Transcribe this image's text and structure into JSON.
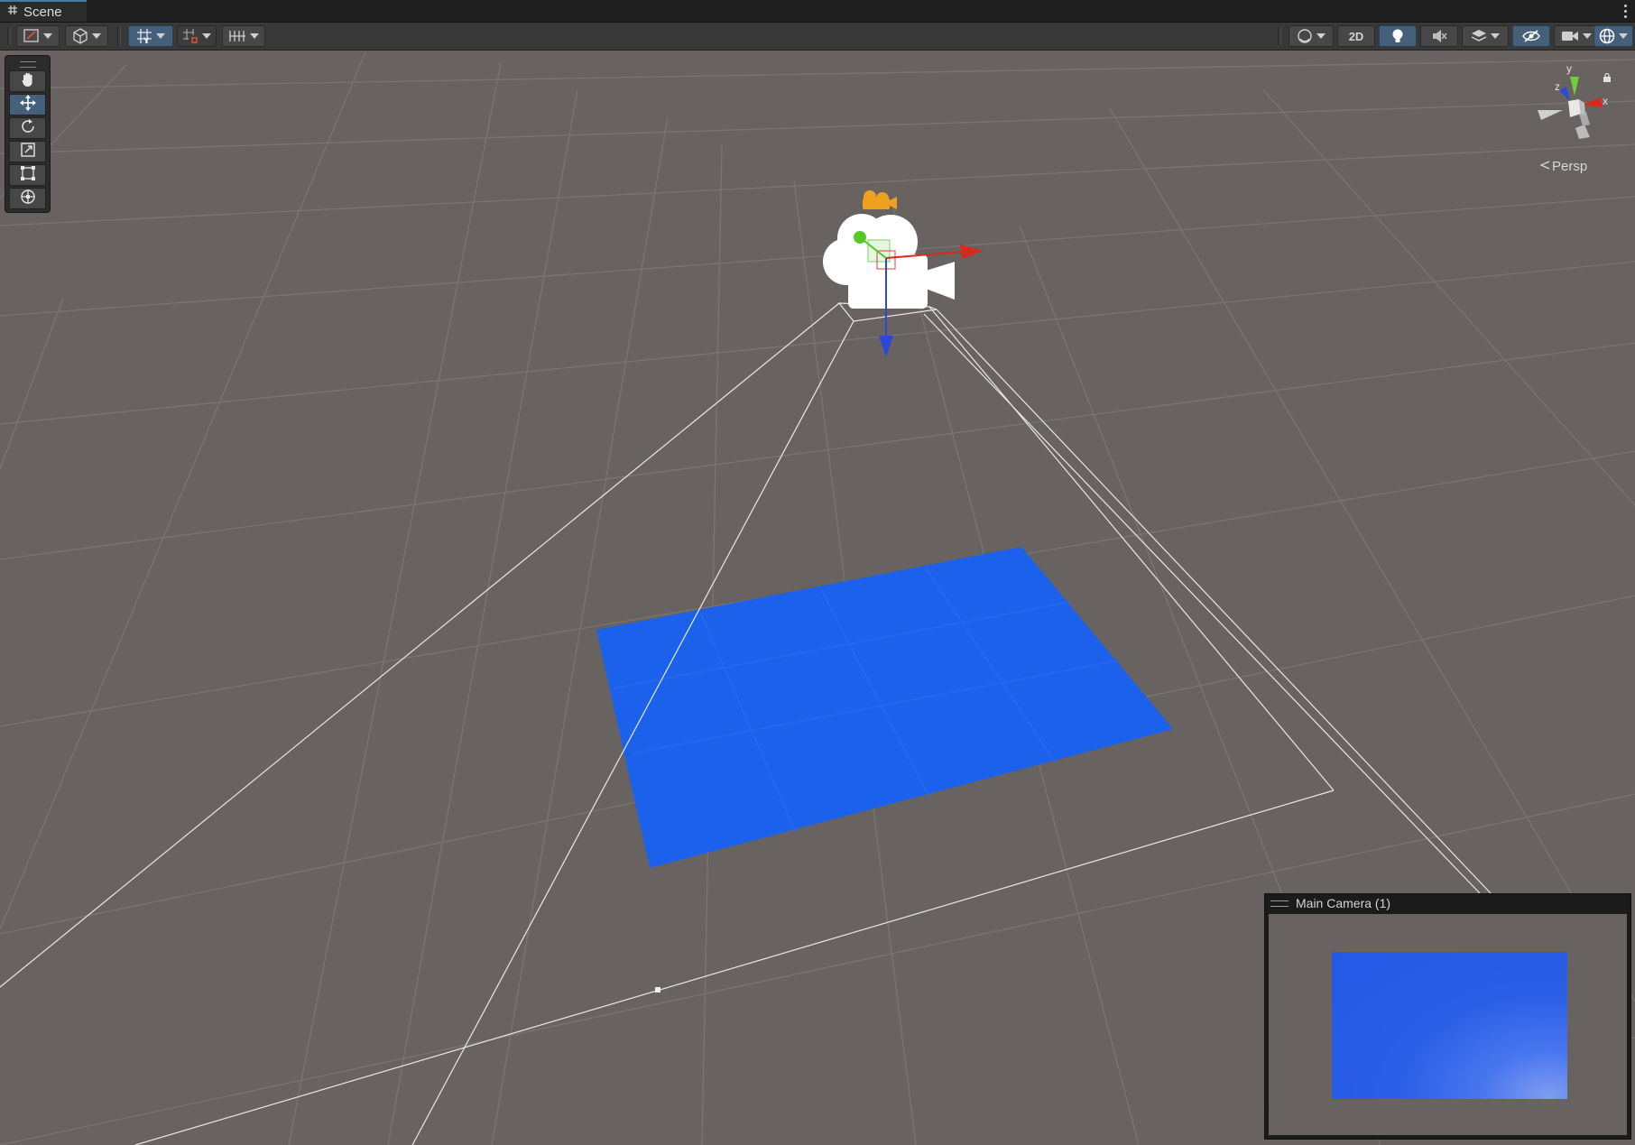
{
  "tab": {
    "title": "Scene",
    "icon": "grid-icon",
    "menu": "kebab-menu-icon"
  },
  "toolbar": {
    "left": [
      {
        "name": "draw-mode-button",
        "icon": "shaded-draw-icon",
        "dropdown": true
      },
      {
        "name": "render-mode-button",
        "icon": "cube-icon",
        "dropdown": true
      },
      {
        "name": "grid-toggle-button",
        "icon": "grid-y-icon",
        "dropdown": true,
        "active": true
      },
      {
        "name": "snap-button",
        "icon": "snap-grid-icon",
        "dropdown": true
      },
      {
        "name": "increment-snap-button",
        "icon": "increment-snap-icon",
        "dropdown": true
      }
    ],
    "right": [
      {
        "name": "shading-button",
        "icon": "sphere-icon",
        "dropdown": true
      },
      {
        "name": "two-d-button",
        "label": "2D"
      },
      {
        "name": "lighting-button",
        "icon": "lightbulb-icon",
        "active": true
      },
      {
        "name": "audio-button",
        "icon": "audio-mute-icon"
      },
      {
        "name": "effects-button",
        "icon": "layers-icon",
        "dropdown": true
      },
      {
        "name": "visibility-button",
        "icon": "eye-hidden-icon",
        "active": true
      },
      {
        "name": "camera-button",
        "icon": "camera-icon",
        "dropdown": true
      },
      {
        "name": "gizmos-button",
        "icon": "gizmo-globe-icon",
        "dropdown": true,
        "active": true
      }
    ],
    "two_d_label": "2D"
  },
  "tools": [
    {
      "name": "hand-tool",
      "icon": "hand-icon",
      "active": false
    },
    {
      "name": "move-tool",
      "icon": "move-arrows-icon",
      "active": true
    },
    {
      "name": "rotate-tool",
      "icon": "rotate-icon",
      "active": false
    },
    {
      "name": "scale-tool",
      "icon": "scale-icon",
      "active": false
    },
    {
      "name": "rect-tool",
      "icon": "rect-transform-icon",
      "active": false
    },
    {
      "name": "transform-tool",
      "icon": "transform-icon",
      "active": false
    }
  ],
  "gizmo": {
    "axes": {
      "x": "x",
      "y": "y",
      "z": "z"
    },
    "projection_label": "Persp",
    "projection_icon": "perspective-chevron-icon"
  },
  "scene": {
    "objects": [
      {
        "name": "Main Camera (1)",
        "type": "camera",
        "icon": "camera-gizmo-icon"
      },
      {
        "name": "plane",
        "type": "plane",
        "color": "#1b61ec"
      }
    ],
    "colors": {
      "background": "#686360",
      "grid": "#7a7572",
      "plane": "#1b61ec",
      "axis_x": "#d42a1f",
      "axis_y": "#55c826",
      "axis_z": "#2f47d6",
      "camera_icon": "#f0a020"
    }
  },
  "camera_preview": {
    "title": "Main Camera (1)",
    "plane_color": "#2359e6"
  }
}
